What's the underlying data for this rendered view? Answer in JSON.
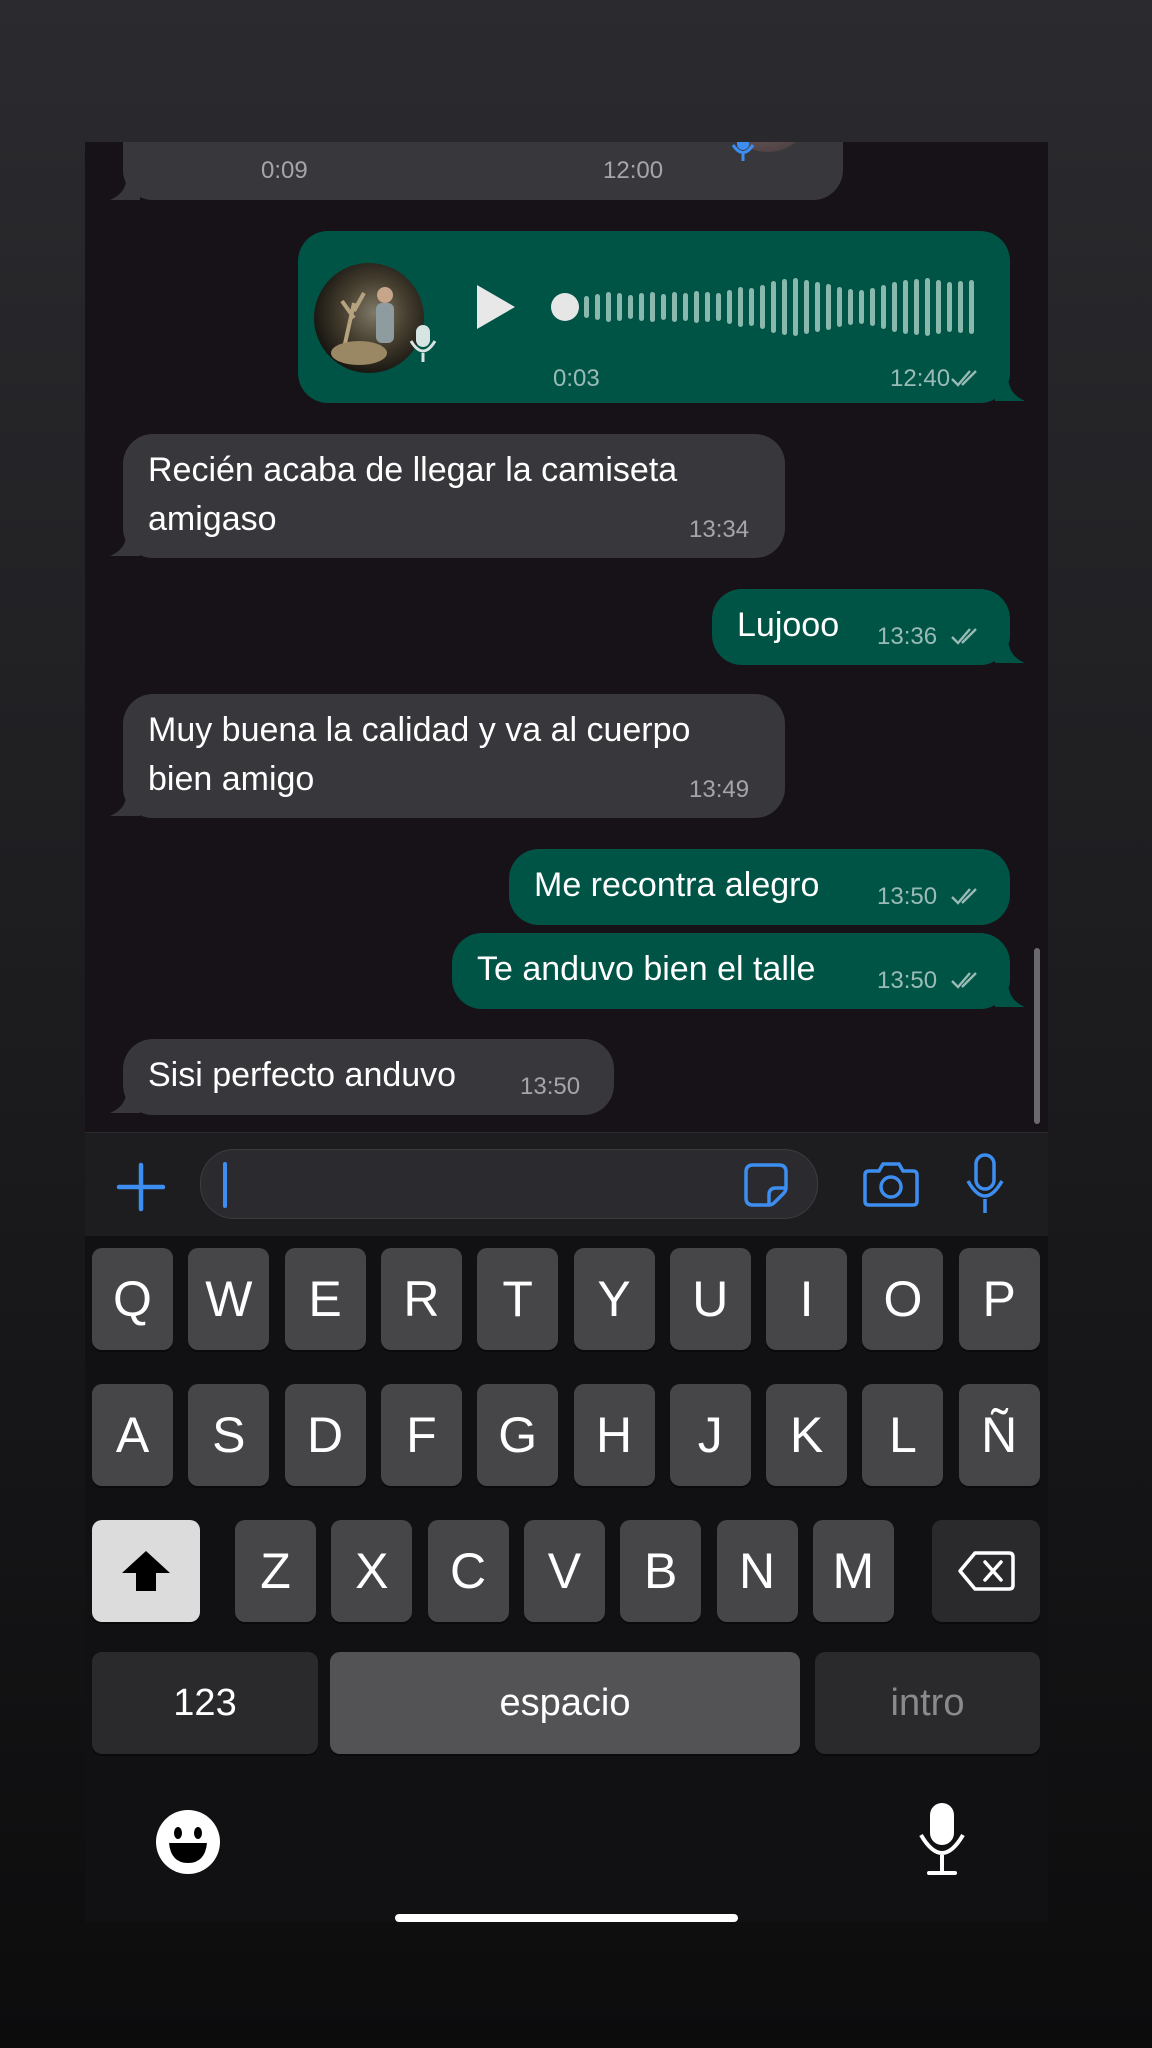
{
  "chat": {
    "messages": [
      {
        "dir": "in",
        "kind": "voice",
        "duration": "0:09",
        "time": "12:00"
      },
      {
        "dir": "out",
        "kind": "voice",
        "duration": "0:03",
        "time": "12:40",
        "status": "read"
      },
      {
        "dir": "in",
        "kind": "text",
        "lines": [
          "Recién acaba de llegar la camiseta",
          "amigaso"
        ],
        "time": "13:34"
      },
      {
        "dir": "out",
        "kind": "text",
        "lines": [
          "Lujooo"
        ],
        "time": "13:36",
        "status": "read"
      },
      {
        "dir": "in",
        "kind": "text",
        "lines": [
          "Muy buena la calidad y va al cuerpo",
          "bien amigo"
        ],
        "time": "13:49"
      },
      {
        "dir": "out",
        "kind": "text",
        "lines": [
          "Me recontra alegro"
        ],
        "time": "13:50",
        "status": "read"
      },
      {
        "dir": "out",
        "kind": "text",
        "lines": [
          "Te anduvo bien el talle"
        ],
        "time": "13:50",
        "status": "read"
      },
      {
        "dir": "in",
        "kind": "text",
        "lines": [
          "Sisi perfecto anduvo"
        ],
        "time": "13:50"
      }
    ]
  },
  "input_bar": {
    "message_value": "",
    "icons": [
      "plus-icon",
      "sticker-icon",
      "camera-icon",
      "microphone-icon"
    ],
    "accent_color": "#3d8ef0"
  },
  "keyboard": {
    "row1": [
      "Q",
      "W",
      "E",
      "R",
      "T",
      "Y",
      "U",
      "I",
      "O",
      "P"
    ],
    "row2": [
      "A",
      "S",
      "D",
      "F",
      "G",
      "H",
      "J",
      "K",
      "L",
      "Ñ"
    ],
    "row3": [
      "Z",
      "X",
      "C",
      "V",
      "B",
      "N",
      "M"
    ],
    "numbers_label": "123",
    "space_label": "espacio",
    "return_label": "intro",
    "icons": [
      "shift-icon",
      "backspace-icon",
      "emoji-icon",
      "dictation-icon"
    ]
  },
  "colors": {
    "incoming_bubble": "#38373c",
    "outgoing_bubble": "#005446",
    "chat_background": "#161217"
  }
}
